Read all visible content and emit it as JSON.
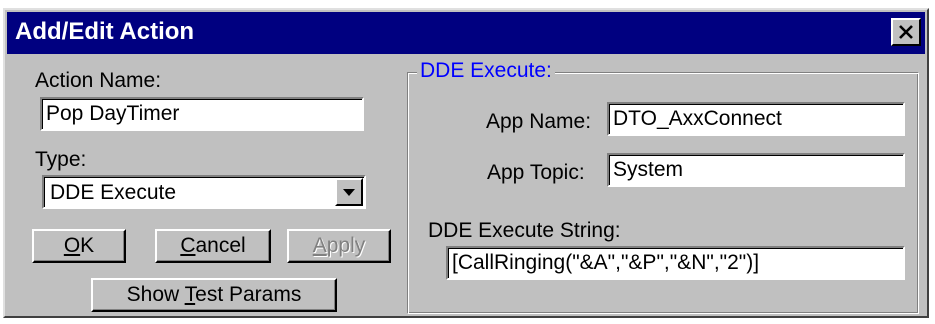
{
  "window": {
    "title": "Add/Edit Action"
  },
  "left": {
    "action_name_label": "Action Name:",
    "action_name_value": "Pop DayTimer",
    "type_label": "Type:",
    "type_value": "DDE Execute"
  },
  "buttons": {
    "ok": {
      "accel": "O",
      "rest": "K"
    },
    "cancel": {
      "accel": "C",
      "rest": "ancel"
    },
    "apply": {
      "accel": "A",
      "rest": "pply",
      "enabled": false
    },
    "show_test_params": {
      "before": "Show ",
      "accel": "T",
      "after": "est Params"
    }
  },
  "dde": {
    "group_title": "DDE Execute:",
    "app_name_label": "App Name:",
    "app_name_value": "DTO_AxxConnect",
    "app_topic_label": "App Topic:",
    "app_topic_value": "System",
    "exec_string_label": "DDE Execute String:",
    "exec_string_value": "[CallRinging(\"&A\",\"&P\",\"&N\",\"2\")]"
  },
  "colors": {
    "titlebar": "#000080",
    "face": "#c0c0c0",
    "group_title": "#0000ff",
    "disabled_text": "#808080"
  },
  "icons": {
    "close": "close-icon",
    "dropdown": "chevron-down-icon"
  }
}
